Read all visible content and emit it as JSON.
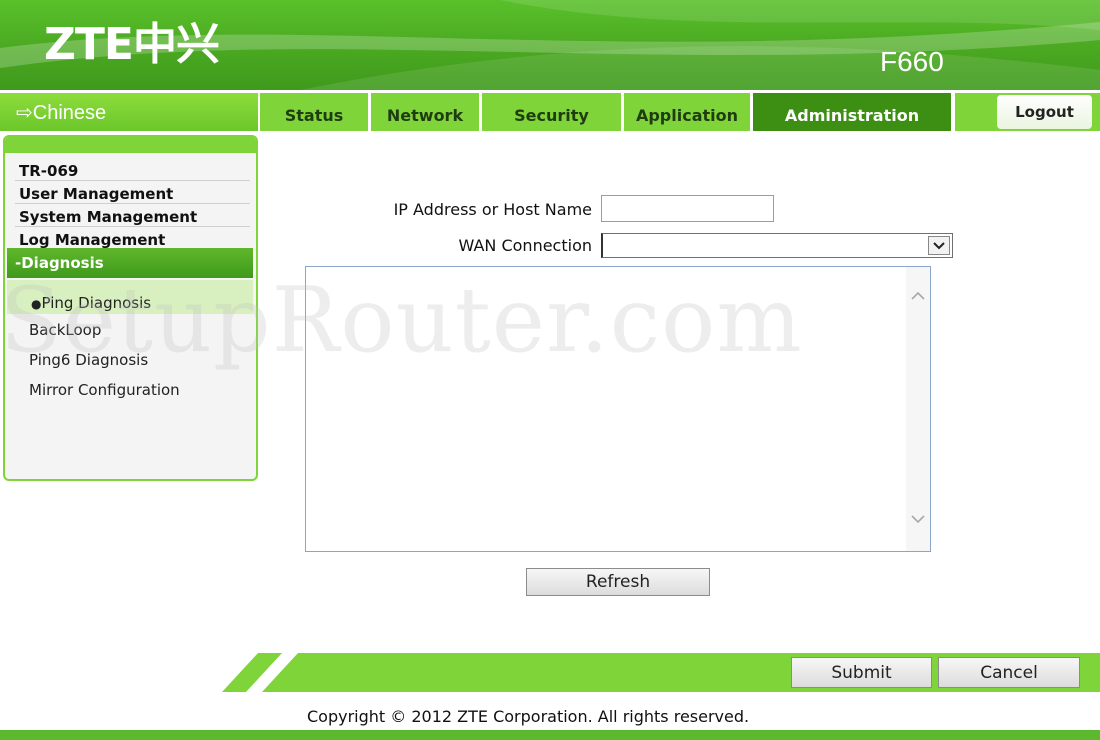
{
  "header": {
    "logo": "ZTE中兴",
    "model": "F660"
  },
  "language_link": "⇨Chinese",
  "tabs": [
    {
      "label": "Status",
      "active": false
    },
    {
      "label": "Network",
      "active": false
    },
    {
      "label": "Security",
      "active": false
    },
    {
      "label": "Application",
      "active": false
    },
    {
      "label": "Administration",
      "active": true
    }
  ],
  "logout_label": "Logout",
  "sidebar": {
    "main_items": [
      "TR-069",
      "User Management",
      "System Management",
      "Log Management"
    ],
    "expanded_section": "-Diagnosis",
    "sub_items": [
      {
        "label": "Ping Diagnosis",
        "active": true
      },
      {
        "label": "BackLoop",
        "active": false
      },
      {
        "label": "Ping6 Diagnosis",
        "active": false
      },
      {
        "label": "Mirror Configuration",
        "active": false
      }
    ],
    "bullet": "●"
  },
  "watermark": "SetupRouter.com",
  "form": {
    "ip_label": "IP Address or Host Name",
    "ip_value": "",
    "wan_label": "WAN Connection",
    "wan_value": "",
    "result_text": "",
    "refresh_label": "Refresh"
  },
  "footer": {
    "submit_label": "Submit",
    "cancel_label": "Cancel",
    "copyright": "Copyright © 2012 ZTE Corporation. All rights reserved."
  },
  "colors": {
    "brand_green": "#4aa821",
    "tab_green": "#7fd43a",
    "active_tab": "#3d8f13"
  }
}
